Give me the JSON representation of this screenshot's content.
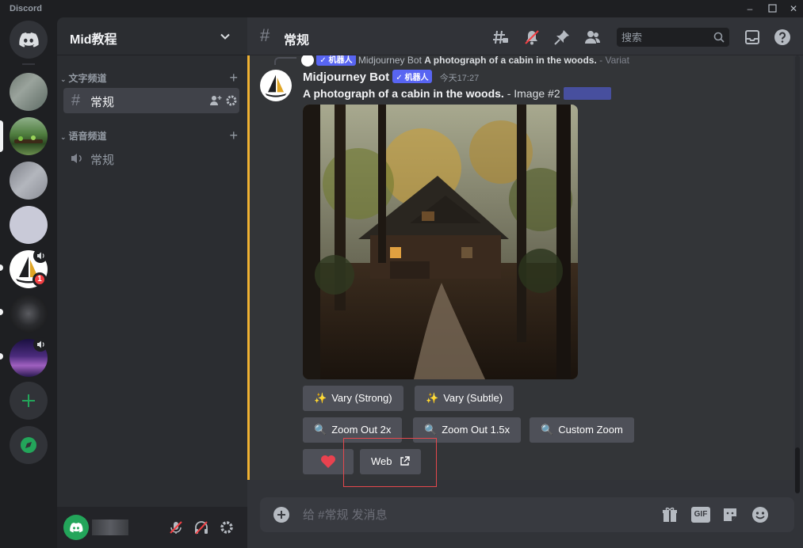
{
  "app": {
    "title": "Discord"
  },
  "guild": {
    "name": "Mid教程"
  },
  "sidebar": {
    "text_category": "文字频道",
    "voice_category": "语音频道",
    "text_channel": "常规",
    "voice_channel": "常规"
  },
  "servers": [
    {
      "name": "blurred-server-1"
    },
    {
      "name": "green-landscape-server"
    },
    {
      "name": "blurred-server-3"
    },
    {
      "name": "blank-server"
    },
    {
      "name": "midjourney-server",
      "badge": "1"
    },
    {
      "name": "blurred-dark-server"
    },
    {
      "name": "purple-server"
    }
  ],
  "header": {
    "channel": "常规",
    "search_placeholder": "搜索"
  },
  "reply": {
    "author": "Midjourney Bot",
    "text": "A photograph of a cabin in the woods.",
    "suffix": " - Variat"
  },
  "message": {
    "author": "Midjourney Bot",
    "bot_tag": "✓ 机器人",
    "timestamp": "今天17:27",
    "prompt": "A photograph of a cabin in the woods.",
    "suffix": " - Image #2"
  },
  "buttons": {
    "vary_strong": "Vary (Strong)",
    "vary_subtle": "Vary (Subtle)",
    "zoom_2x": "Zoom Out 2x",
    "zoom_15x": "Zoom Out 1.5x",
    "custom_zoom": "Custom Zoom",
    "web": "Web"
  },
  "composer": {
    "placeholder": "给 #常规 发消息",
    "gif": "GIF"
  },
  "colors": {
    "accent": "#5865f2",
    "mention": "#f0b232",
    "highlight": "#e5484d",
    "online": "#23a55a"
  }
}
